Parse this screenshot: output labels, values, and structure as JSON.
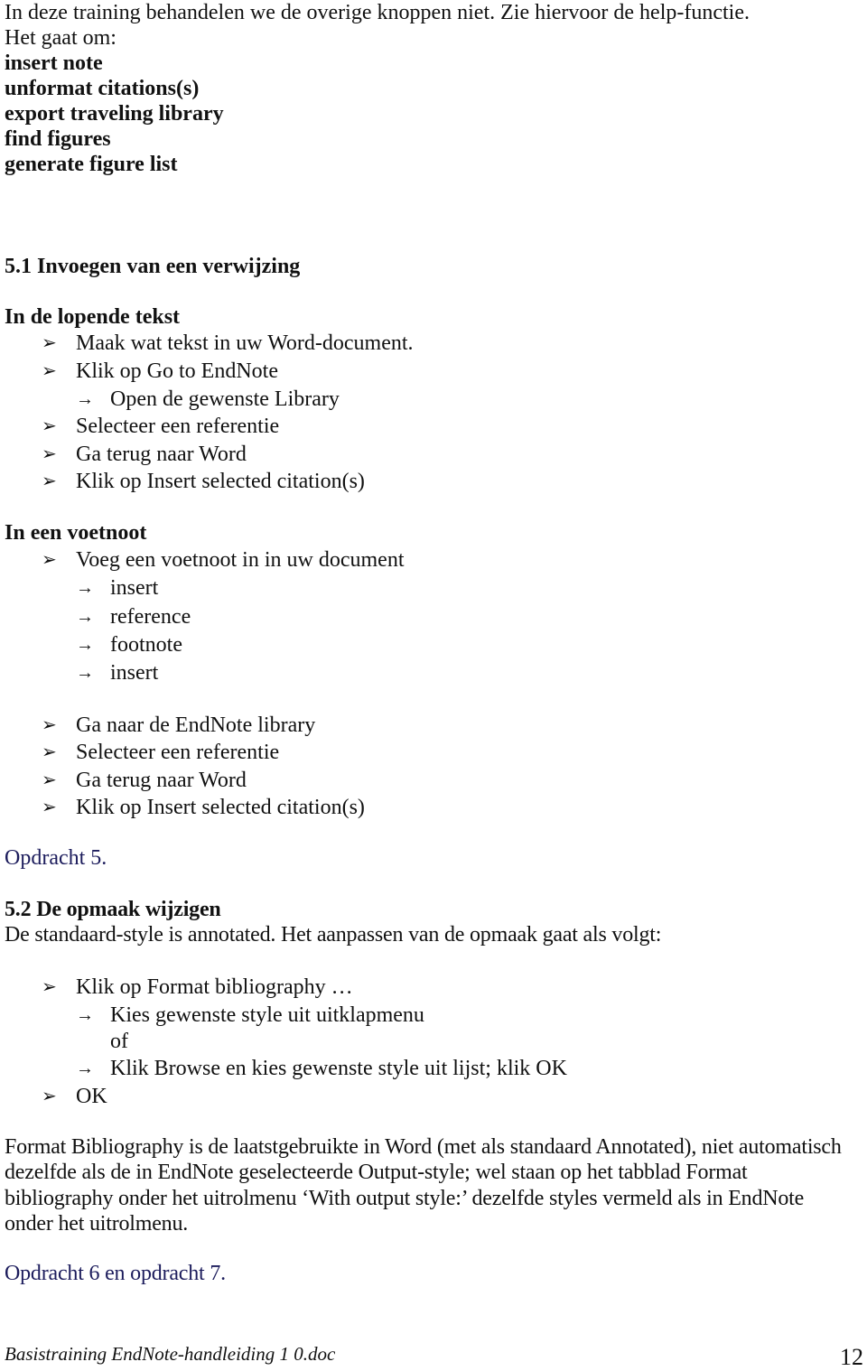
{
  "intro": {
    "line1": "In deze training behandelen we de overige knoppen niet. Zie hiervoor de help-functie.",
    "line2": "Het gaat om:",
    "items": [
      "insert note",
      "unformat citations(s)",
      "export traveling library",
      "find figures",
      "generate figure list"
    ]
  },
  "section51": {
    "heading": "5.1 Invoegen van een verwijzing",
    "sub1": {
      "heading": "In de lopende tekst",
      "steps": [
        {
          "type": "bullet",
          "text": "Maak wat tekst in uw Word-document."
        },
        {
          "type": "bullet",
          "text": "Klik op Go to EndNote"
        },
        {
          "type": "arrow",
          "text": "Open de gewenste Library"
        },
        {
          "type": "bullet",
          "text": "Selecteer een referentie"
        },
        {
          "type": "bullet",
          "text": "Ga terug naar Word"
        },
        {
          "type": "bullet",
          "text": "Klik op Insert selected citation(s)"
        }
      ]
    },
    "sub2": {
      "heading": "In een voetnoot",
      "steps": [
        {
          "type": "bullet",
          "text": "Voeg een voetnoot in in uw document"
        },
        {
          "type": "arrow",
          "text": "insert"
        },
        {
          "type": "arrow",
          "text": "reference"
        },
        {
          "type": "arrow",
          "text": "footnote"
        },
        {
          "type": "arrow",
          "text": "insert"
        },
        {
          "type": "bullet",
          "text": "Ga naar de EndNote library"
        },
        {
          "type": "bullet",
          "text": "Selecteer een referentie"
        },
        {
          "type": "bullet",
          "text": "Ga terug naar Word"
        },
        {
          "type": "bullet",
          "text": "Klik op Insert selected citation(s)"
        }
      ]
    },
    "assignment": "Opdracht 5."
  },
  "section52": {
    "heading": "5.2 De opmaak wijzigen",
    "intro": "De standaard-style is annotated. Het aanpassen van de opmaak gaat als volgt:",
    "steps": [
      {
        "type": "bullet",
        "text": "Klik op Format bibliography …"
      },
      {
        "type": "arrow",
        "text": "Kies gewenste style uit uitklapmenu"
      },
      {
        "type": "plain",
        "text": "of"
      },
      {
        "type": "arrow",
        "text": "Klik Browse en kies gewenste style uit lijst; klik OK"
      },
      {
        "type": "bullet",
        "text": "OK"
      }
    ],
    "paragraph": "Format Bibliography is de laatstgebruikte in Word (met als standaard Annotated), niet automatisch dezelfde als de in EndNote geselecteerde Output-style; wel staan op het tabblad Format bibliography onder het uitrolmenu ‘With output style:’ dezelfde styles vermeld als in EndNote onder het uitrolmenu.",
    "assignment": "Opdracht 6 en opdracht 7."
  },
  "footer": {
    "filename": "Basistraining EndNote-handleiding 1 0.doc",
    "page_number": "12"
  },
  "glyphs": {
    "bullet": "➢",
    "arrow": "→"
  },
  "colors": {
    "text": "#111111",
    "assignment": "#1c1c5c"
  }
}
